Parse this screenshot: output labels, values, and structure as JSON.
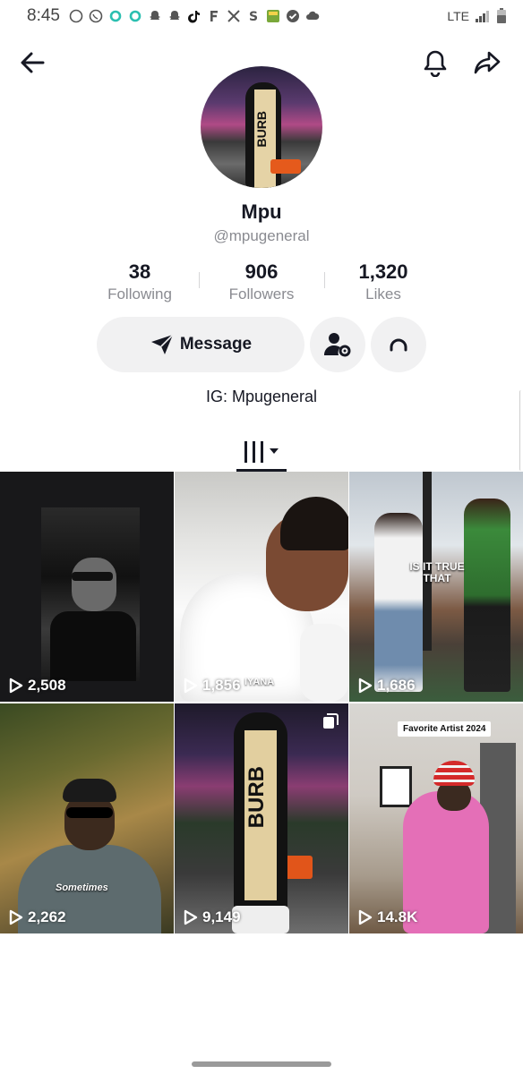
{
  "status_bar": {
    "time": "8:45",
    "network": "LTE"
  },
  "header": {
    "back_icon": "back-arrow-icon",
    "bell_icon": "bell-icon",
    "share_icon": "share-arrow-icon"
  },
  "profile": {
    "name": "Mpu",
    "handle": "@mpugeneral",
    "avatar_scarf_text": "BURB",
    "bio": "IG: Mpugeneral"
  },
  "stats": [
    {
      "value": "38",
      "label": "Following"
    },
    {
      "value": "906",
      "label": "Followers"
    },
    {
      "value": "1,320",
      "label": "Likes"
    }
  ],
  "actions": {
    "message_label": "Message",
    "message_icon": "send-icon",
    "add_friend_icon": "person-settings-icon",
    "repost_icon": "loop-icon"
  },
  "tabs": {
    "active_icon": "grid-icon"
  },
  "videos": [
    {
      "views": "2,508"
    },
    {
      "views": "1,856",
      "watermark": "IYANA"
    },
    {
      "views": "1,686",
      "caption": "IS IT TRUE THAT"
    },
    {
      "views": "2,262",
      "caption": "Sometimes"
    },
    {
      "views": "9,149",
      "scarf_text": "BURB"
    },
    {
      "views": "14.8K",
      "banner": "Favorite Artist 2024"
    }
  ],
  "colors": {
    "text_primary": "#161823",
    "text_secondary": "#8a8b91",
    "button_bg": "#f1f1f2"
  }
}
